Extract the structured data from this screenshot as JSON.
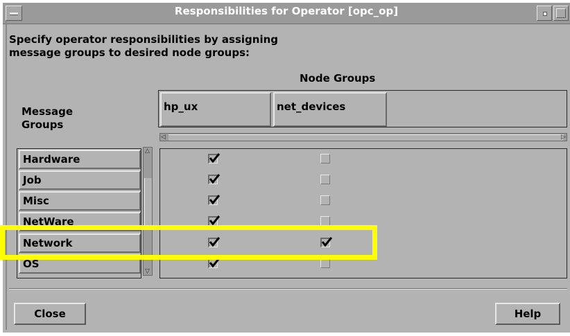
{
  "window": {
    "title": "Responsibilities for Operator [opc_op]"
  },
  "instructions": {
    "line1": "Specify operator responsibilities by assigning",
    "line2": "message groups to desired node groups:"
  },
  "node_groups_label": "Node Groups",
  "message_groups_label": {
    "line1": "Message",
    "line2": "Groups"
  },
  "columns": [
    "hp_ux",
    "net_devices"
  ],
  "rows": [
    {
      "label": "Hardware",
      "hp_ux": true,
      "net_devices": false
    },
    {
      "label": "Job",
      "hp_ux": true,
      "net_devices": false
    },
    {
      "label": "Misc",
      "hp_ux": true,
      "net_devices": false
    },
    {
      "label": "NetWare",
      "hp_ux": true,
      "net_devices": false
    },
    {
      "label": "Network",
      "hp_ux": true,
      "net_devices": true
    },
    {
      "label": "OS",
      "hp_ux": true,
      "net_devices": false
    }
  ],
  "highlighted_row": "Network",
  "buttons": {
    "close": "Close",
    "help": "Help"
  },
  "colors": {
    "highlight": "#ffff00",
    "window_bg": "#b3b3b3",
    "titlebar": "#9a9a9a"
  }
}
